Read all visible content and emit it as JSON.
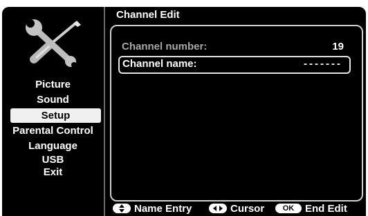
{
  "sidebar": {
    "icon": "tools-icon",
    "items": [
      {
        "label": "Picture",
        "selected": false
      },
      {
        "label": "Sound",
        "selected": false
      },
      {
        "label": "Setup",
        "selected": true
      },
      {
        "label": "Parental Control",
        "selected": false
      },
      {
        "label": "Language",
        "selected": false
      },
      {
        "label": "USB",
        "selected": false
      },
      {
        "label": "Exit",
        "selected": false
      }
    ]
  },
  "page": {
    "title": "Channel Edit"
  },
  "form": {
    "channel_number_label": "Channel number:",
    "channel_number_value": "19",
    "channel_name_label": "Channel name:",
    "channel_name_value": "-------"
  },
  "footer": {
    "name_entry_key": "up-down-arrows-icon",
    "name_entry_label": "Name Entry",
    "cursor_key": "left-right-arrows-icon",
    "cursor_label": "Cursor",
    "end_edit_key": "OK",
    "end_edit_label": "End Edit"
  },
  "colors": {
    "background": "#000000",
    "panel_border": "#d0d0d0",
    "selected_bg": "#f0f0f0",
    "dim_text": "#a8a8a8"
  }
}
